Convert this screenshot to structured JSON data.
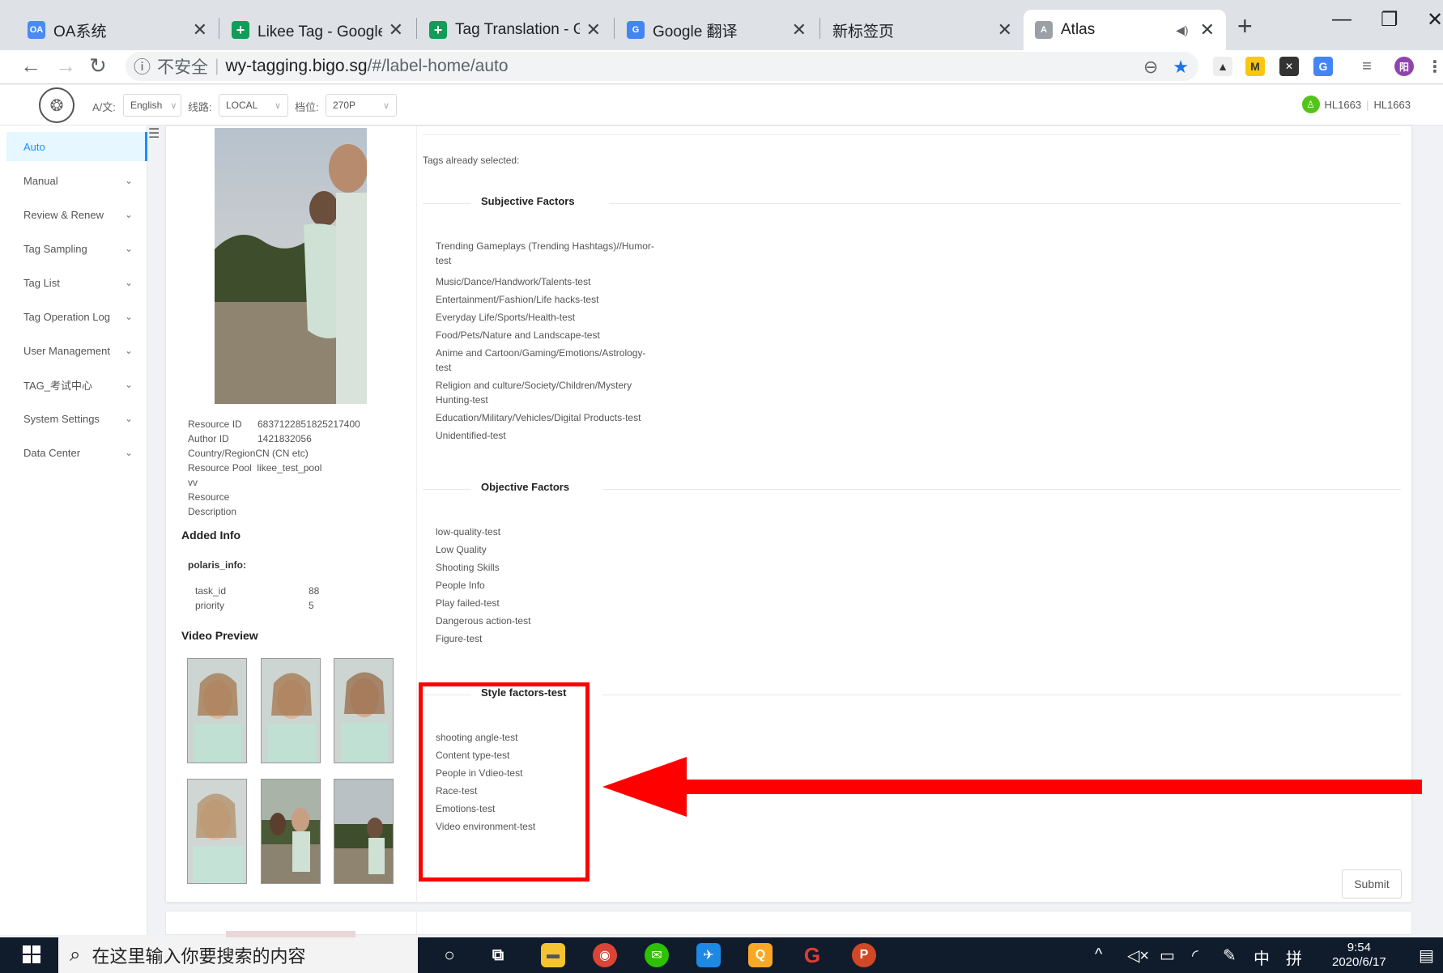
{
  "browser": {
    "tabs": [
      {
        "title": "OA系统",
        "favicon": "OA"
      },
      {
        "title": "Likee Tag - Google 表",
        "favicon": "+"
      },
      {
        "title": "Tag Translation - Goo",
        "favicon": "+"
      },
      {
        "title": "Google 翻译",
        "favicon": "G"
      },
      {
        "title": "新标签页",
        "favicon": ""
      },
      {
        "title": "Atlas",
        "favicon": "A"
      }
    ],
    "address": {
      "insecure_label": "不安全",
      "host": "wy-tagging.bigo.sg",
      "path": "/#/label-home/auto"
    },
    "profile_initial": "阳"
  },
  "header": {
    "lang_label": "A/文:",
    "lang_value": "English",
    "route_label": "线路:",
    "route_value": "LOCAL",
    "quality_label": "档位:",
    "quality_value": "270P",
    "user_name": "HL1663",
    "user_id": "HL1663"
  },
  "sidebar": {
    "items": [
      {
        "label": "Auto"
      },
      {
        "label": "Manual"
      },
      {
        "label": "Review & Renew"
      },
      {
        "label": "Tag Sampling"
      },
      {
        "label": "Tag List"
      },
      {
        "label": "Tag Operation Log"
      },
      {
        "label": "User Management"
      },
      {
        "label": "TAG_考试中心"
      },
      {
        "label": "System Settings"
      },
      {
        "label": "Data Center"
      }
    ]
  },
  "resource": {
    "resource_id_label": "Resource ID",
    "resource_id": "6837122851825217400",
    "author_id_label": "Author ID",
    "author_id": "1421832056",
    "country_label": "Country/Region",
    "country": "CN (CN etc)",
    "pool_label": "Resource Pool",
    "pool": "likee_test_pool",
    "pool_extra": "vv",
    "desc_label_1": "Resource",
    "desc_label_2": "Description",
    "added_info_title": "Added Info",
    "polaris_label": "polaris_info:",
    "task_id_label": "task_id",
    "task_id": "88",
    "priority_label": "priority",
    "priority": "5",
    "video_preview_title": "Video Preview"
  },
  "tags": {
    "selected_label": "Tags already selected:",
    "subjective_title": "Subjective Factors",
    "subjective": [
      "Trending Gameplays (Trending Hashtags)//Humor-",
      "test",
      "Music/Dance/Handwork/Talents-test",
      "Entertainment/Fashion/Life hacks-test",
      "Everyday Life/Sports/Health-test",
      "Food/Pets/Nature and Landscape-test",
      "Anime and Cartoon/Gaming/Emotions/Astrology-",
      "test",
      "Religion and culture/Society/Children/Mystery",
      "Hunting-test",
      "Education/Military/Vehicles/Digital Products-test",
      "Unidentified-test"
    ],
    "objective_title": "Objective Factors",
    "objective": [
      "low-quality-test",
      "Low Quality",
      "Shooting Skills",
      "People Info",
      "Play failed-test",
      "Dangerous action-test",
      "Figure-test"
    ],
    "style_title": "Style factors-test",
    "style": [
      "shooting angle-test",
      "Content type-test",
      "People in Vdieo-test",
      "Race-test",
      "Emotions-test",
      "Video environment-test"
    ],
    "submit_label": "Submit"
  },
  "taskbar": {
    "search_placeholder": "在这里输入你要搜索的内容",
    "ime_lang": "中",
    "ime_mode": "拼",
    "time": "9:54",
    "date": "2020/6/17"
  },
  "colors": {
    "accent": "#1890ff",
    "highlight": "#ff0000",
    "taskbar": "#101c2c"
  }
}
